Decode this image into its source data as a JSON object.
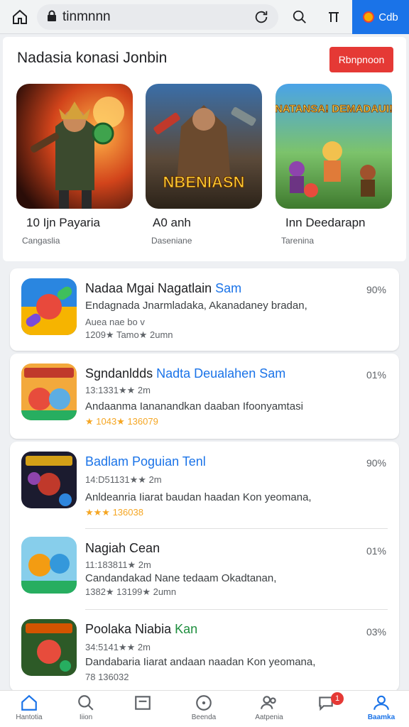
{
  "browser": {
    "url": "tinmnnn",
    "profile_label": "Cdb"
  },
  "featured": {
    "title": "Nadasia konasi Jonbin",
    "button_label": "Rbnpnoon",
    "items": [
      {
        "name": "10 Ijn Payaria",
        "category": "Cangaslia"
      },
      {
        "name": "A0 anh",
        "category": "Daseniane",
        "art_text": "NBENIASN"
      },
      {
        "name": "Inn Deedarapn",
        "category": "Tarenina",
        "art_text": "NATANSA! DEMADAUI!"
      }
    ]
  },
  "apps": [
    {
      "name_main": "Nadaa Mgai Nagatlain ",
      "name_hl": "Sam",
      "percent": "90%",
      "desc": "Endagnada Jnarmladaka, Akanadaney bradan,",
      "desc2": "Auea nae bo  v",
      "meta": "1209★ Tamo★ 2umn"
    },
    {
      "name_main": "Sgndanldds ",
      "name_hl": "Nadta Deualahen Sam",
      "percent": "01%",
      "meta": "13:1331★★ 2m",
      "desc": "Andaanma Iananandkan daaban Ifoonyamtasi",
      "rating": "★ 1043★ 136079"
    },
    {
      "name_main": "",
      "name_hl": "Badlam Poguian Tenl",
      "percent": "90%",
      "meta": "14:D51131★★ 2m",
      "desc": "Anldeanria Iiarat baudan haadan Kon yeomana,",
      "rating": "★★★ 136038"
    },
    {
      "name_main": "Nagiah Cean",
      "name_hl": "",
      "percent": "01%",
      "meta": "11:183811★ 2m",
      "desc": "Candandakad Nane tedaam Okadtanan,",
      "rating": "1382★ 13199★ 2umn"
    },
    {
      "name_main": "Poolaka Niabia ",
      "name_hl": "Kan",
      "percent": "03%",
      "meta": "34:5141★★ 2m",
      "desc": "Dandabaria Iiarat andaan naadan Kon yeomana,",
      "rating": "78 136032"
    }
  ],
  "bottom_nav": [
    {
      "label": "Hantotia",
      "icon": "home-icon"
    },
    {
      "label": "Iiion",
      "icon": "search-icon"
    },
    {
      "label": "",
      "icon": "news-icon"
    },
    {
      "label": "Beenda",
      "icon": "games-icon"
    },
    {
      "label": "Aatpenia",
      "icon": "people-icon"
    },
    {
      "label": "",
      "icon": "chat-icon",
      "badge": "1"
    },
    {
      "label": "Baamka",
      "icon": "profile-icon"
    }
  ],
  "colors": {
    "accent": "#1a73e8",
    "red": "#e53935",
    "star": "#f5a623"
  }
}
